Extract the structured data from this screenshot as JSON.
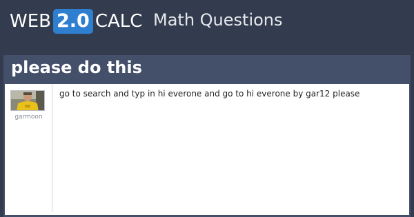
{
  "header": {
    "logo_left": "WEB",
    "logo_badge": "2.0",
    "logo_right": "CALC",
    "section": "Math Questions"
  },
  "question": {
    "title": "please do this",
    "body": "go to search and typ in hi everone and go to hi everone by gar12 please"
  },
  "user": {
    "name": "garmoon"
  },
  "colors": {
    "background": "#323c4e",
    "panel": "#44506a",
    "badge": "#2f7fd1"
  }
}
